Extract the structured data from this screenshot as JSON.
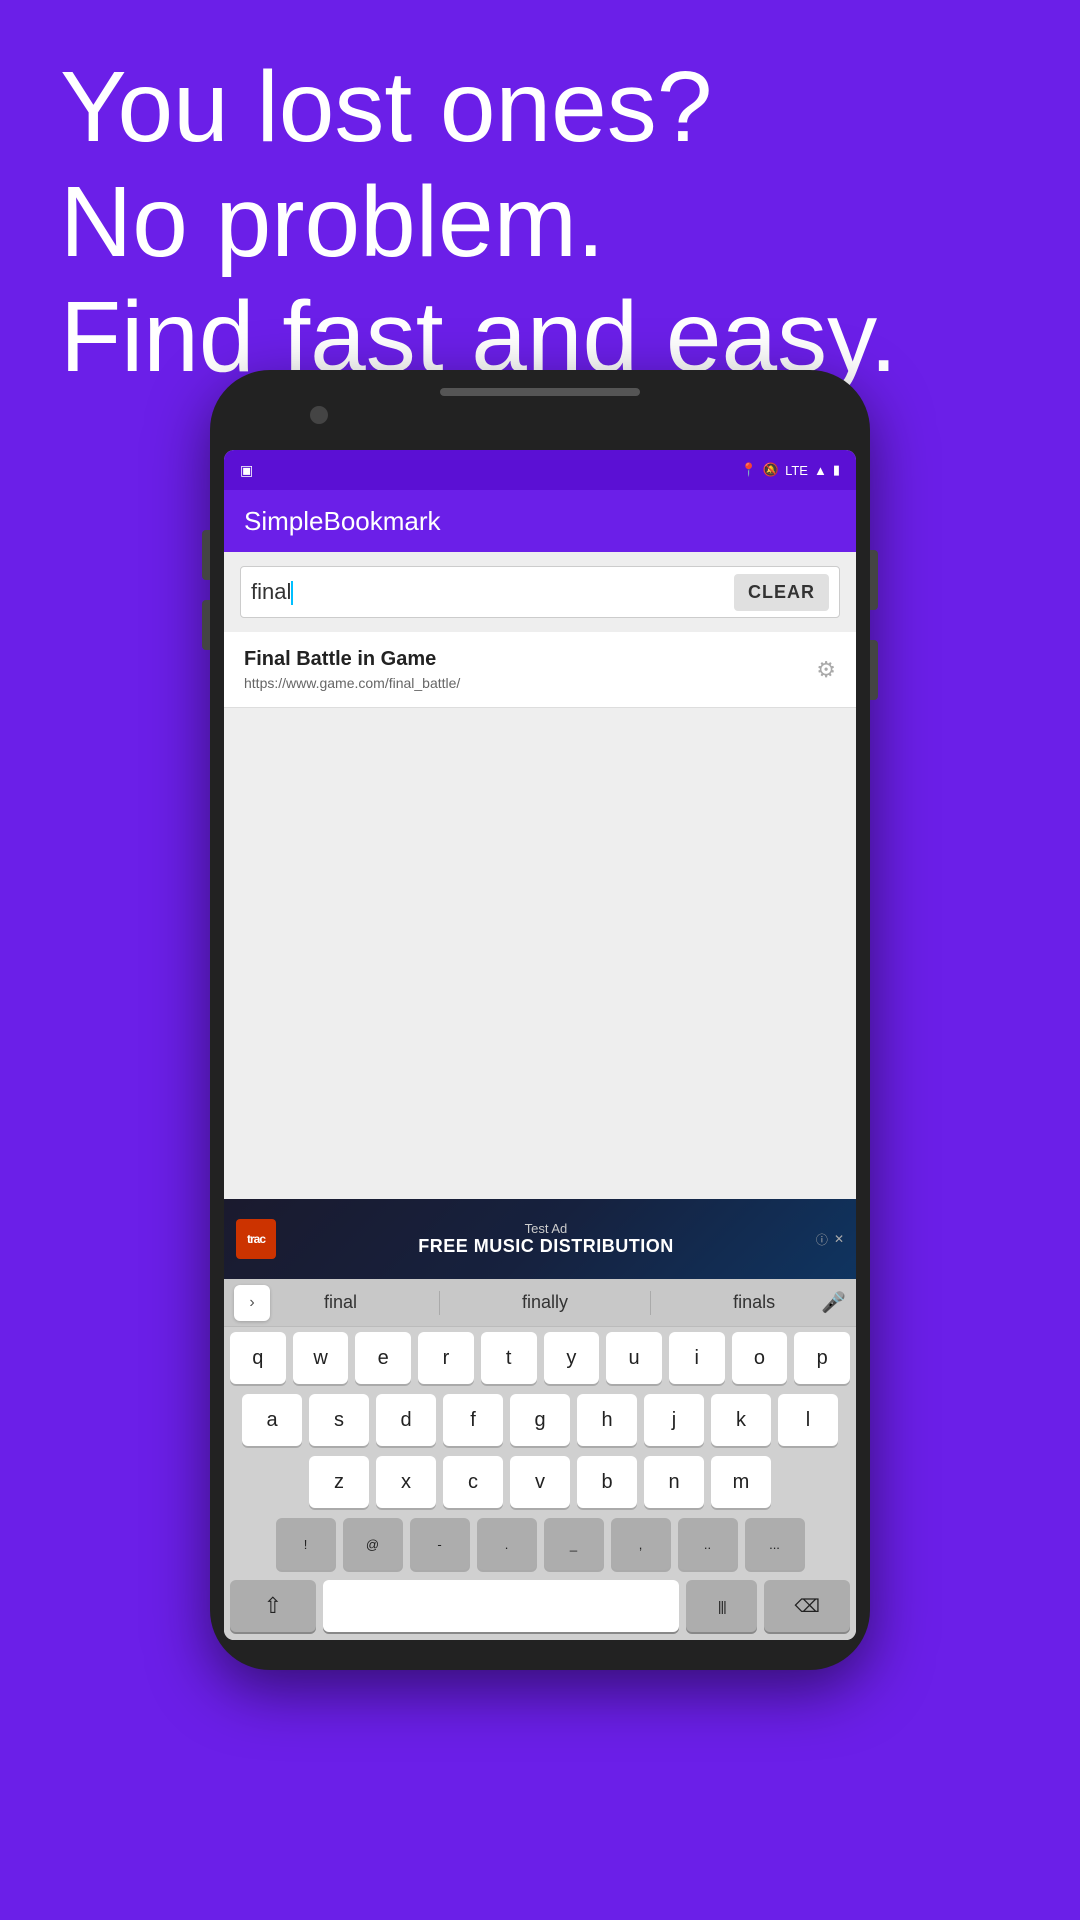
{
  "hero": {
    "line1": "You lost ones?",
    "line2": "No problem.",
    "line3": "Find fast and easy."
  },
  "status_bar": {
    "left_icon": "📋",
    "right_items": [
      "📍",
      "🔕",
      "LTE",
      "📶",
      "🔋"
    ]
  },
  "app_bar": {
    "title": "SimpleBookmark"
  },
  "search": {
    "value": "final",
    "clear_label": "CLEAR"
  },
  "results": [
    {
      "title": "Final Battle in Game",
      "url": "https://www.game.com/final_battle/"
    }
  ],
  "ad": {
    "label": "Test Ad",
    "logo_text": "trac",
    "main_text": "FREE MUSIC DISTRIBUTION",
    "info_icon": "ⓘ",
    "close_icon": "✕"
  },
  "keyboard": {
    "autocomplete": {
      "arrow": "›",
      "suggestions": [
        "final",
        "finally",
        "finals"
      ],
      "mic_icon": "🎤"
    },
    "rows": [
      [
        "q",
        "w",
        "e",
        "r",
        "t",
        "y",
        "u",
        "i",
        "o",
        "p"
      ],
      [
        "a",
        "s",
        "d",
        "f",
        "g",
        "h",
        "j",
        "k",
        "l"
      ],
      [
        "z",
        "x",
        "c",
        "v",
        "b",
        "n",
        "m"
      ]
    ],
    "special_row": [
      "!",
      "@",
      "_",
      ".",
      "..",
      "..."
    ],
    "bottom": {
      "shift": "⇧",
      "space": "",
      "pipe": "|||",
      "backspace": "⌫"
    }
  }
}
